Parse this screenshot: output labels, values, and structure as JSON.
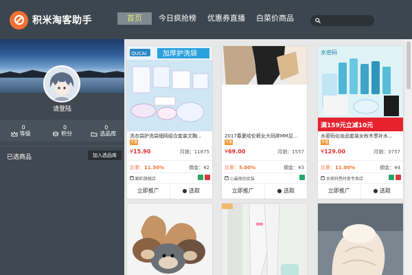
{
  "app": {
    "title": "积米淘客助手"
  },
  "nav": {
    "items": [
      {
        "label": "首页",
        "active": true
      },
      {
        "label": "今日疯抢榜",
        "active": false
      },
      {
        "label": "优惠券直播",
        "active": false
      },
      {
        "label": "白菜价商品",
        "active": false
      }
    ],
    "search_placeholder": ""
  },
  "sidebar": {
    "login_text": "请登陆",
    "stats": [
      {
        "value": "0",
        "label": "等级",
        "icon": "crown-icon"
      },
      {
        "value": "0",
        "label": "积分",
        "icon": "coins-icon"
      },
      {
        "value": "0",
        "label": "选品库",
        "icon": "folder-icon"
      }
    ],
    "selected_label": "已选商品",
    "add_button": "加入选品库"
  },
  "products": [
    {
      "title": "洗衣袋护洗袋细网组合套装文胸...",
      "badge": "天猫",
      "price_symbol": "¥",
      "price": "15.90",
      "sales": "月销：11875",
      "rate_label": "比率：",
      "rate": "11.50%",
      "commission": "佣金：¥2",
      "shop": "翻彩旗舰店",
      "promote": "立即推广",
      "select": "选取"
    },
    {
      "title": "2017春夏哈伦裤女大码胖MM显...",
      "badge": "天猫",
      "price_symbol": "¥",
      "price": "69.00",
      "sales": "月销：1557",
      "rate_label": "比率：",
      "rate": "5.00%",
      "commission": "佣金：¥3",
      "shop": "心最原创女装",
      "promote": "立即推广",
      "select": "选取"
    },
    {
      "title": "水密码化妆品套装女秋冬季补水...",
      "badge": "天猫",
      "price_symbol": "¥",
      "price": "129.00",
      "sales": "月销：3757",
      "rate_label": "比率：",
      "rate": "11.00%",
      "commission": "佣金：¥4",
      "shop": "水密码叁时美专卖店",
      "promote": "立即推广",
      "select": "选取"
    }
  ],
  "thumb_texts": {
    "p1_brand": "QUCAI",
    "p1_banner": "加厚护洗袋",
    "p3_brand": "水密码",
    "p3_promo": "满159元立减10元"
  },
  "colors": {
    "header_bg": "#3c464e",
    "sidebar_bg": "#404951",
    "accent_orange": "#f07033",
    "price_red": "#e02c2c",
    "nav_active_text": "#e6ea7a"
  }
}
